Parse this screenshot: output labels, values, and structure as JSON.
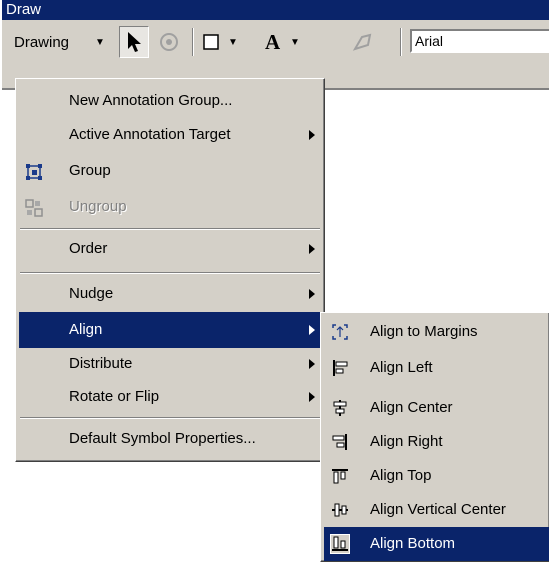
{
  "toolbar": {
    "title": "Draw",
    "drawing_label": "Drawing",
    "dropdown_glyph": "▼",
    "font_value": "Arial",
    "icons": [
      "select-elements-icon",
      "rotate-icon",
      "rectangle-icon",
      "text-icon",
      "edit-vertices-icon"
    ]
  },
  "drawing_menu": {
    "items": [
      {
        "label": "New Annotation Group..."
      },
      {
        "label": "Active Annotation Target"
      },
      {
        "label": "Group"
      },
      {
        "label": "Ungroup"
      },
      {
        "label": "Order"
      },
      {
        "label": "Nudge"
      },
      {
        "label": "Align"
      },
      {
        "label": "Distribute"
      },
      {
        "label": "Rotate or Flip"
      },
      {
        "label": "Default Symbol Properties..."
      }
    ]
  },
  "align_menu": {
    "items": [
      {
        "label": "Align to Margins",
        "icon": "align-to-margins-icon"
      },
      {
        "label": "Align Left",
        "icon": "align-left-icon"
      },
      {
        "label": "Align Center",
        "icon": "align-center-icon"
      },
      {
        "label": "Align Right",
        "icon": "align-right-icon"
      },
      {
        "label": "Align Top",
        "icon": "align-top-icon"
      },
      {
        "label": "Align Vertical Center",
        "icon": "align-vertical-center-icon"
      },
      {
        "label": "Align Bottom",
        "icon": "align-bottom-icon"
      }
    ]
  },
  "colors": {
    "menu_bg": "#d4d0c8",
    "highlight": "#0a246a",
    "highlight_text": "#ffffff",
    "disabled_text": "#808080"
  }
}
